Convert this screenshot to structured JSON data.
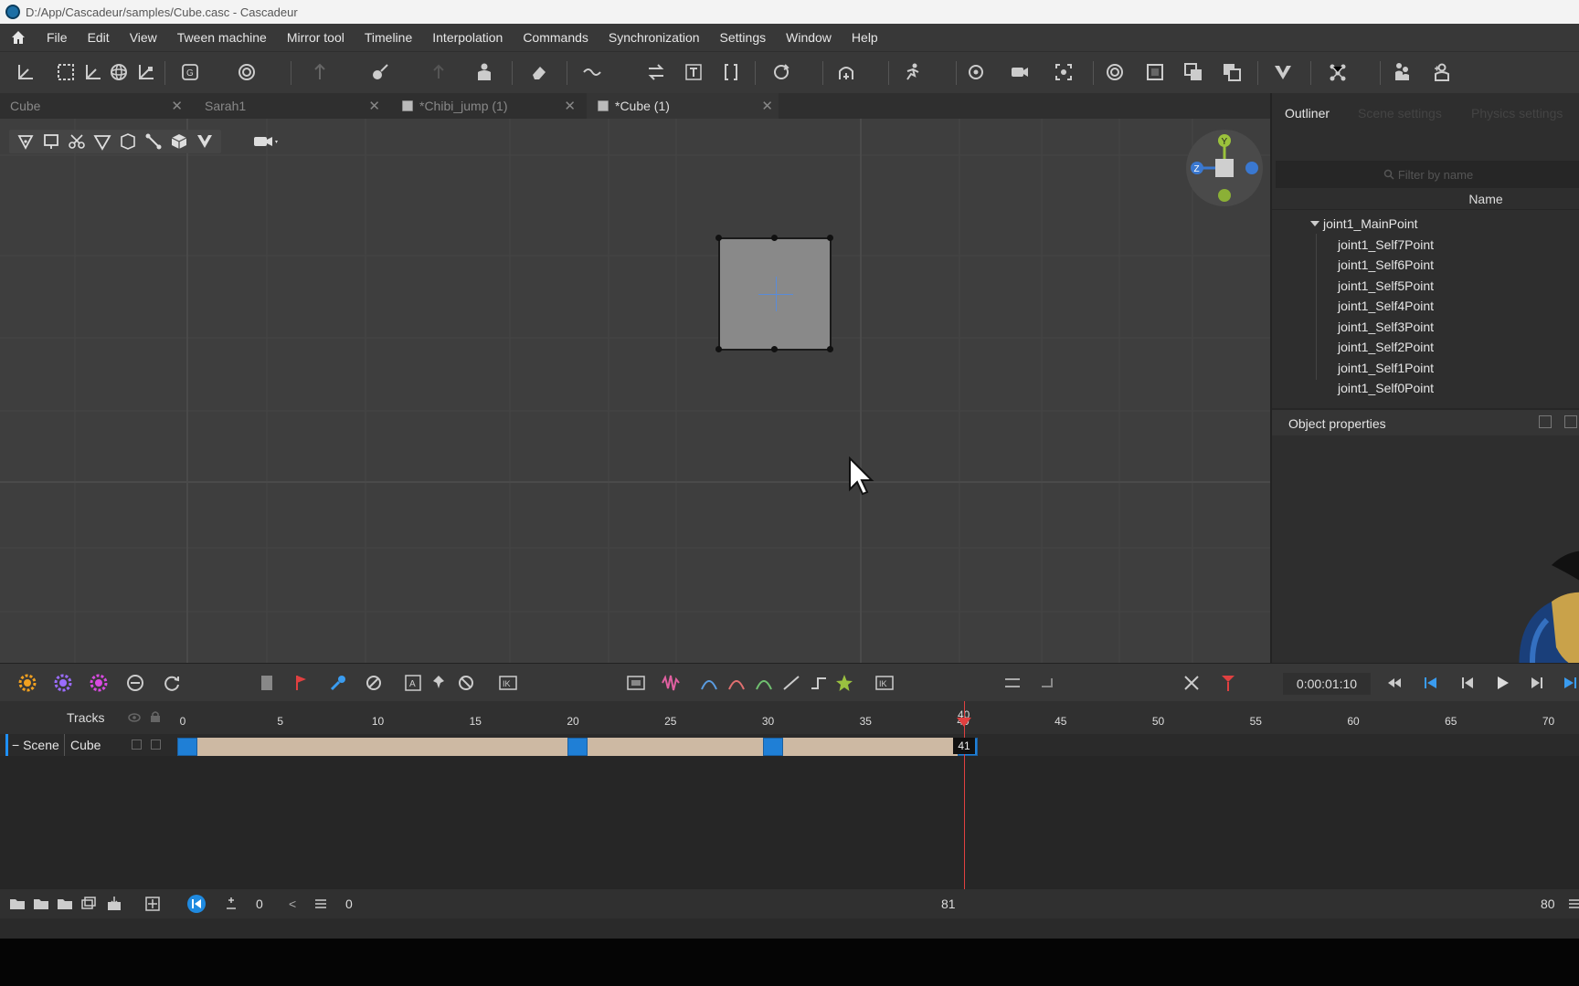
{
  "window": {
    "title": "D:/App/Cascadeur/samples/Cube.casc - Cascadeur"
  },
  "menu": [
    "File",
    "Edit",
    "View",
    "Tween machine",
    "Mirror tool",
    "Timeline",
    "Interpolation",
    "Commands",
    "Synchronization",
    "Settings",
    "Window",
    "Help"
  ],
  "tabs": [
    {
      "label": "Cube",
      "active": false
    },
    {
      "label": "Sarah1",
      "active": false
    },
    {
      "label": "*Chibi_jump (1)",
      "active": false
    },
    {
      "label": "*Cube (1)",
      "active": true
    }
  ],
  "right_panel": {
    "tabs": [
      "Outliner",
      "Scene settings",
      "Physics settings"
    ],
    "filter_placeholder": "Filter by name",
    "name_header": "Name",
    "tree_root": "joint1_MainPoint",
    "tree_children": [
      "joint1_Self7Point",
      "joint1_Self6Point",
      "joint1_Self5Point",
      "joint1_Self4Point",
      "joint1_Self3Point",
      "joint1_Self2Point",
      "joint1_Self1Point",
      "joint1_Self0Point"
    ],
    "object_properties": "Object properties"
  },
  "timeline": {
    "time": "0:00:01:10",
    "tracks_label": "Tracks",
    "scene_label": "Scene",
    "cube_label": "Cube",
    "ruler_ticks": [
      "0",
      "5",
      "10",
      "15",
      "20",
      "25",
      "30",
      "35",
      "40",
      "45",
      "50",
      "55",
      "60",
      "65",
      "70"
    ],
    "keyframes": [
      0,
      20,
      30,
      40
    ],
    "current_frame": "41",
    "playhead_top": "40"
  },
  "bottom": {
    "a": "0",
    "b": "0",
    "mid": "81",
    "end": "80"
  },
  "colors": {
    "accent": "#1f7fd6",
    "playhead": "#e04040",
    "clip": "#cdb9a3"
  }
}
